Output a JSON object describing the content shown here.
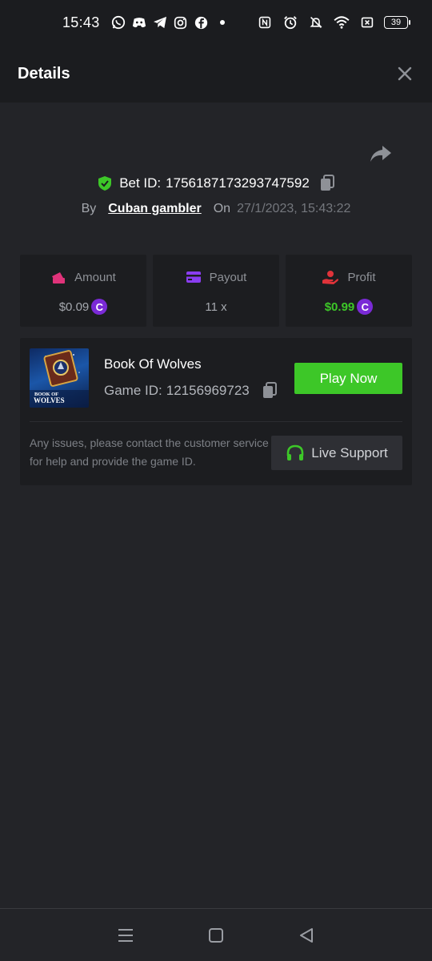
{
  "status_bar": {
    "time": "15:43",
    "battery": "39",
    "left_icons": [
      "whatsapp-icon",
      "discord-icon",
      "telegram-icon",
      "instagram-icon",
      "facebook-icon",
      "dot-icon"
    ],
    "right_icons": [
      "nfc-icon",
      "alarm-icon",
      "bell-off-icon",
      "wifi-icon",
      "close-box-icon",
      "battery-icon"
    ]
  },
  "header": {
    "title": "Details"
  },
  "bet": {
    "id_label": "Bet ID:",
    "id_value": "1756187173293747592",
    "by_label": "By",
    "user": "Cuban gambler",
    "on_label": "On",
    "datetime": "27/1/2023, 15:43:22"
  },
  "stats": {
    "amount": {
      "label": "Amount",
      "value": "$0.09"
    },
    "payout": {
      "label": "Payout",
      "value": "11 x"
    },
    "profit": {
      "label": "Profit",
      "value": "$0.99"
    },
    "coin_symbol": "C"
  },
  "game": {
    "name": "Book Of Wolves",
    "id_label": "Game ID:",
    "id_value": "12156969723",
    "thumb_text": "BOOK OF WOLVES",
    "play_button": "Play Now",
    "help_text": "Any issues, please contact the customer service for help and provide the game ID.",
    "support_button": "Live Support"
  },
  "colors": {
    "background": "#232428",
    "header": "#1b1c1f",
    "card": "#1c1d20",
    "accent_green": "#3dc728",
    "coin_purple": "#7a2ad6",
    "amount_icon": "#e0337a",
    "payout_icon": "#8a3df0",
    "profit_icon": "#e0333a"
  }
}
